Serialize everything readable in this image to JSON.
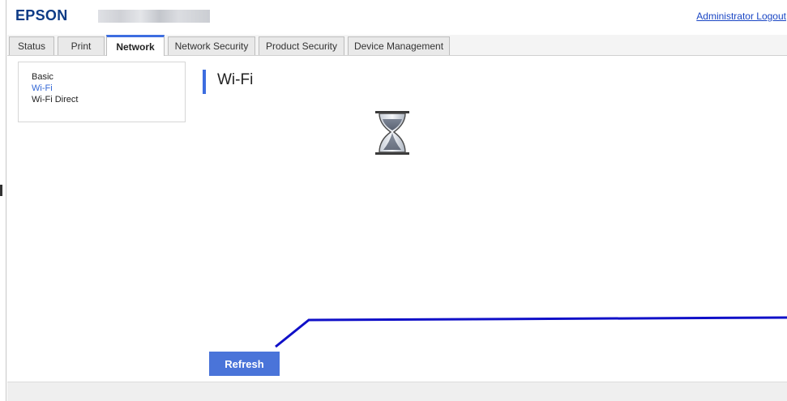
{
  "header": {
    "logo": "EPSON",
    "admin_link": "Administrator Logout"
  },
  "tabs": [
    {
      "label": "Status",
      "active": false
    },
    {
      "label": "Print",
      "active": false
    },
    {
      "label": "Network",
      "active": true
    },
    {
      "label": "Network Security",
      "active": false
    },
    {
      "label": "Product Security",
      "active": false
    },
    {
      "label": "Device Management",
      "active": false
    }
  ],
  "sidebar": {
    "items": [
      {
        "label": "Basic",
        "active": false
      },
      {
        "label": "Wi-Fi",
        "active": true
      },
      {
        "label": "Wi-Fi Direct",
        "active": false
      }
    ]
  },
  "main": {
    "title": "Wi-Fi",
    "status_icon": "hourglass-icon",
    "refresh_label": "Refresh"
  },
  "colors": {
    "brand": "#0d3b86",
    "accent": "#3d6de0",
    "button": "#4a74d9",
    "link": "#1a46c4",
    "annotation_line": "#1010c8"
  }
}
